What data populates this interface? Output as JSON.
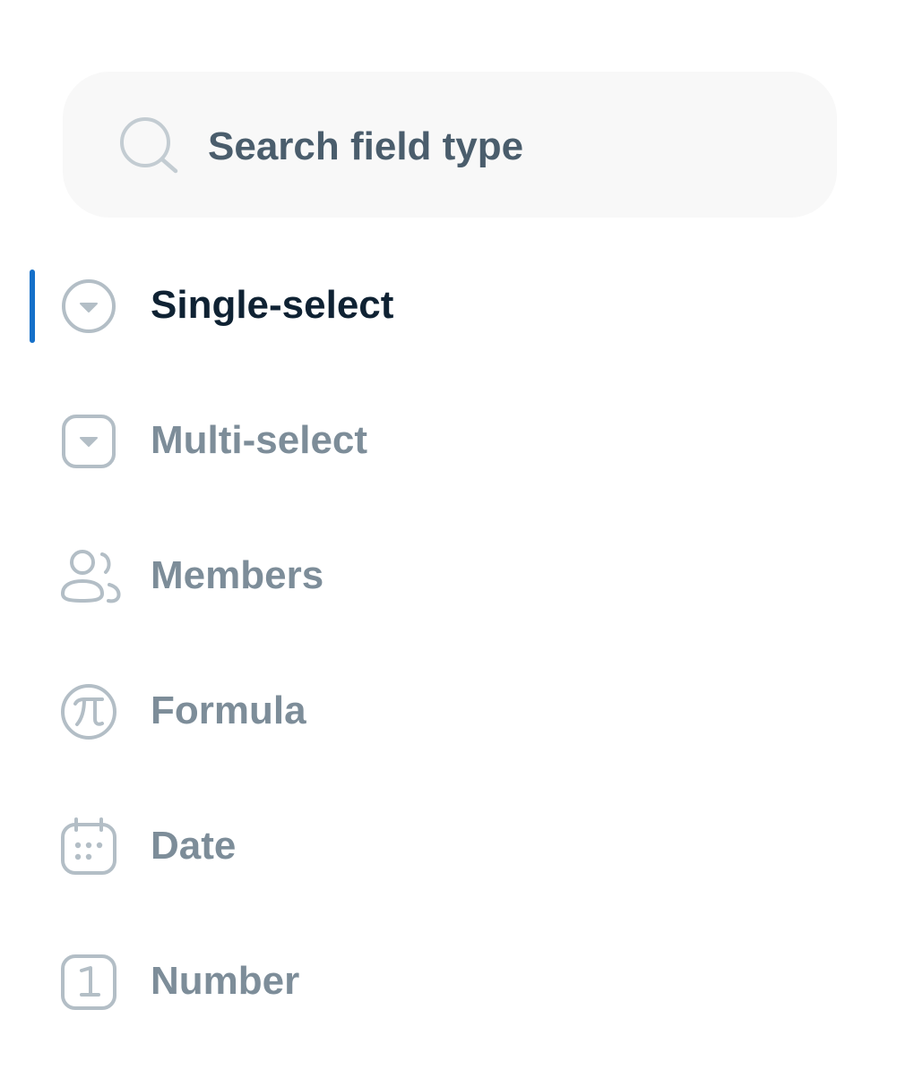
{
  "search": {
    "placeholder": "Search field type",
    "icon": "search-icon"
  },
  "field_types": [
    {
      "label": "Single-select",
      "icon": "single-select-icon",
      "active": true
    },
    {
      "label": "Multi-select",
      "icon": "multi-select-icon",
      "active": false
    },
    {
      "label": "Members",
      "icon": "members-icon",
      "active": false
    },
    {
      "label": "Formula",
      "icon": "formula-pi-icon",
      "active": false
    },
    {
      "label": "Date",
      "icon": "calendar-icon",
      "active": false
    },
    {
      "label": "Number",
      "icon": "number-icon",
      "active": false
    }
  ],
  "colors": {
    "accent": "#1570c9",
    "active_text": "#0f2233",
    "inactive_text": "#7d8d99",
    "icon_stroke": "#b3bec6",
    "search_bg": "#f8f8f8",
    "search_text": "#4a5d6c"
  }
}
